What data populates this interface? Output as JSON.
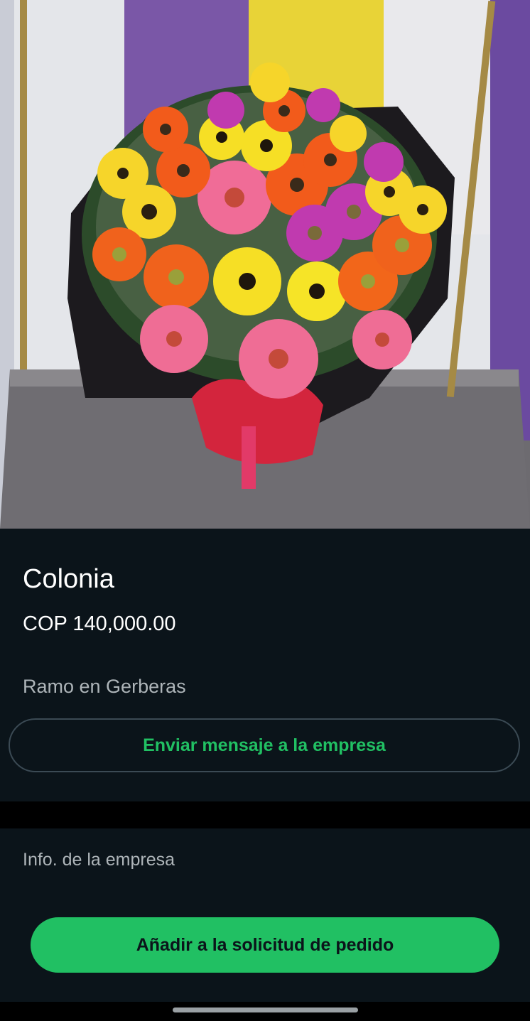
{
  "product": {
    "image_subject": "flower-bouquet-image",
    "name": "Colonia",
    "price": "COP 140,000.00",
    "description": "Ramo en Gerberas"
  },
  "actions": {
    "message_business_label": "Enviar mensaje a la empresa",
    "add_to_order_label": "Añadir a la solicitud de pedido"
  },
  "business": {
    "info_label": "Info. de la empresa"
  },
  "colors": {
    "background": "#0b141a",
    "accent_green": "#21c063",
    "muted_text": "#aeb5b9"
  }
}
